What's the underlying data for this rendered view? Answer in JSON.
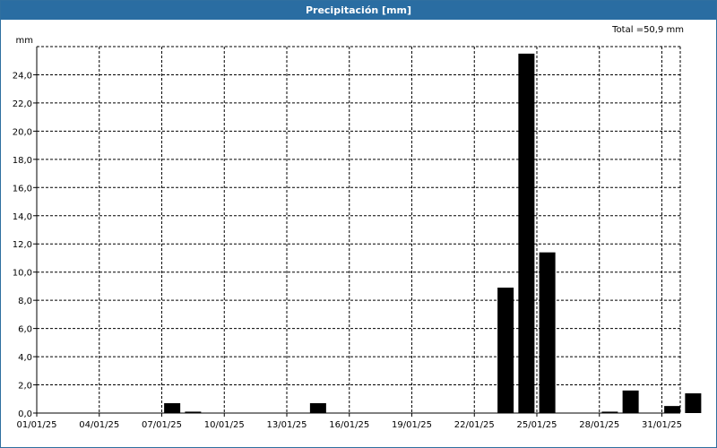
{
  "window": {
    "title": "Precipitación [mm]"
  },
  "chart_data": {
    "type": "bar",
    "title": "Precipitación [mm]",
    "total_label": "Total =50,9 mm",
    "ylabel": "mm",
    "ylim": [
      0,
      26
    ],
    "y_ticks": [
      "0,0",
      "2,0",
      "4,0",
      "6,0",
      "8,0",
      "10,0",
      "12,0",
      "14,0",
      "16,0",
      "18,0",
      "20,0",
      "22,0",
      "24,0"
    ],
    "x_ticks": [
      "01/01/25",
      "04/01/25",
      "07/01/25",
      "10/01/25",
      "13/01/25",
      "16/01/25",
      "19/01/25",
      "22/01/25",
      "25/01/25",
      "28/01/25",
      "31/01/25"
    ],
    "grid": true,
    "bar_color": "#000000",
    "x": [
      "01/01/25",
      "02/01/25",
      "03/01/25",
      "04/01/25",
      "05/01/25",
      "06/01/25",
      "07/01/25",
      "08/01/25",
      "09/01/25",
      "10/01/25",
      "11/01/25",
      "12/01/25",
      "13/01/25",
      "14/01/25",
      "15/01/25",
      "16/01/25",
      "17/01/25",
      "18/01/25",
      "19/01/25",
      "20/01/25",
      "21/01/25",
      "22/01/25",
      "23/01/25",
      "24/01/25",
      "25/01/25",
      "26/01/25",
      "27/01/25",
      "28/01/25",
      "29/01/25",
      "30/01/25",
      "31/01/25"
    ],
    "values": [
      0,
      0,
      0,
      0,
      0,
      0,
      0.7,
      0.1,
      0,
      0,
      0,
      0,
      0,
      0.7,
      0,
      0,
      0,
      0,
      0,
      0,
      0,
      0,
      8.9,
      25.5,
      11.4,
      0,
      0,
      0.1,
      1.6,
      0,
      0.5,
      1.4
    ]
  }
}
